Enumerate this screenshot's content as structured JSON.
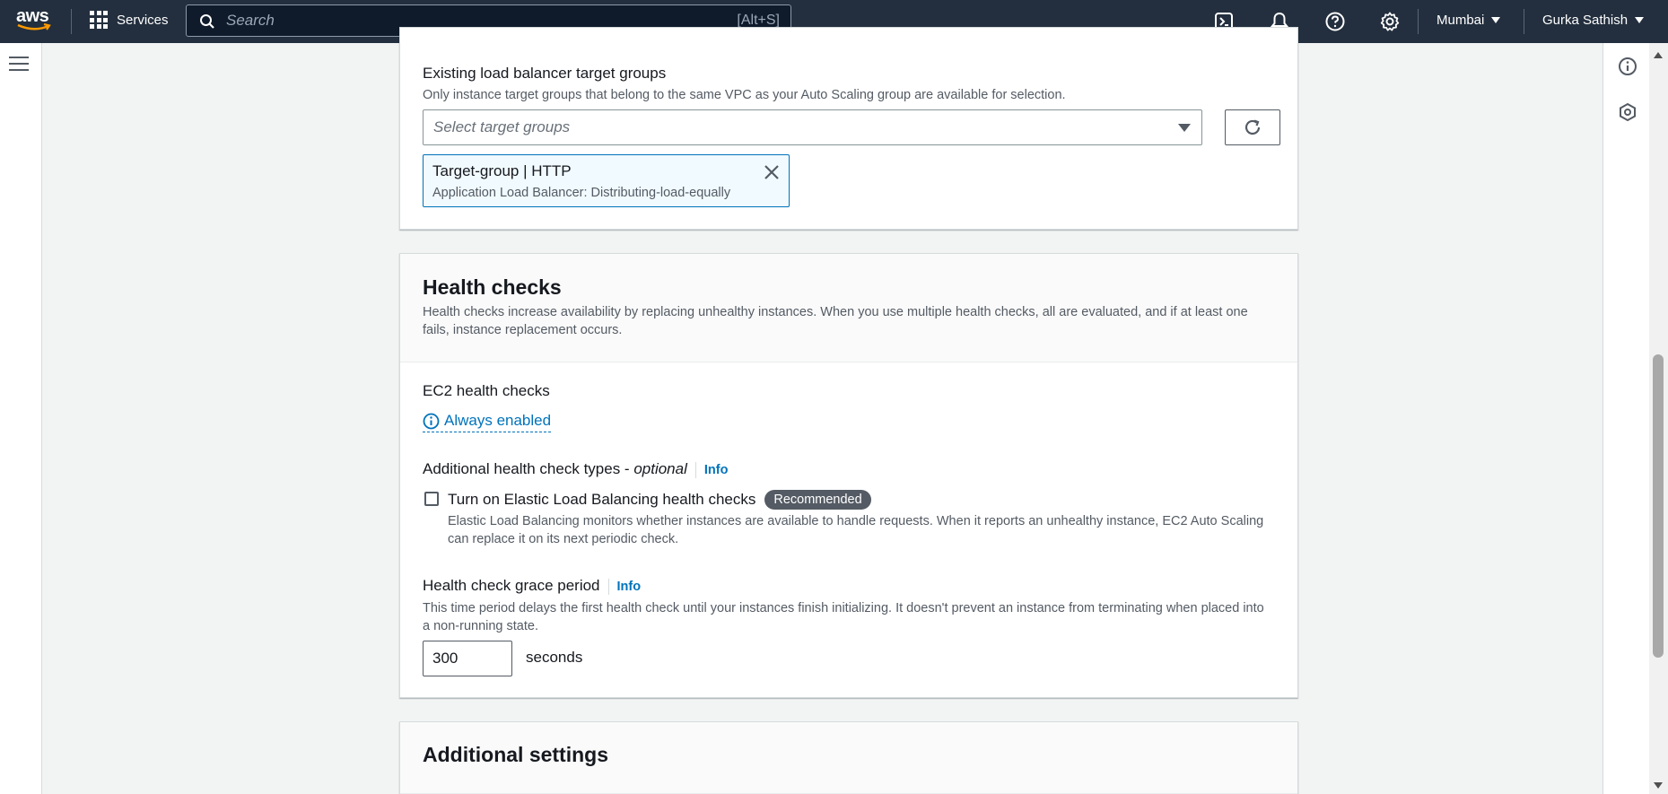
{
  "topnav": {
    "logo_text": "aws",
    "services_label": "Services",
    "search_placeholder": "Search",
    "search_shortcut": "[Alt+S]",
    "region": "Mumbai",
    "user": "Gurka Sathish"
  },
  "target_groups": {
    "label": "Existing load balancer target groups",
    "description": "Only instance target groups that belong to the same VPC as your Auto Scaling group are available for selection.",
    "select_placeholder": "Select target groups",
    "token_title": "Target-group | HTTP",
    "token_subtitle": "Application Load Balancer: Distributing-load-equally"
  },
  "health_checks": {
    "title": "Health checks",
    "description": "Health checks increase availability by replacing unhealthy instances. When you use multiple health checks, all are evaluated, and if at least one fails, instance replacement occurs.",
    "ec2_label": "EC2 health checks",
    "ec2_status": "Always enabled",
    "additional_label": "Additional health check types - ",
    "additional_optional": "optional",
    "info": "Info",
    "elb_checkbox_label": "Turn on Elastic Load Balancing health checks",
    "elb_checked": false,
    "recommended_badge": "Recommended",
    "elb_description": "Elastic Load Balancing monitors whether instances are available to handle requests. When it reports an unhealthy instance, EC2 Auto Scaling can replace it on its next periodic check.",
    "grace_label": "Health check grace period",
    "grace_description": "This time period delays the first health check until your instances finish initializing. It doesn't prevent an instance from terminating when placed into a non-running state.",
    "grace_value": "300",
    "grace_unit": "seconds"
  },
  "additional_settings": {
    "title": "Additional settings"
  },
  "colors": {
    "nav_bg": "#232f3e",
    "link": "#0073bb",
    "token_bg": "#f1faff"
  }
}
